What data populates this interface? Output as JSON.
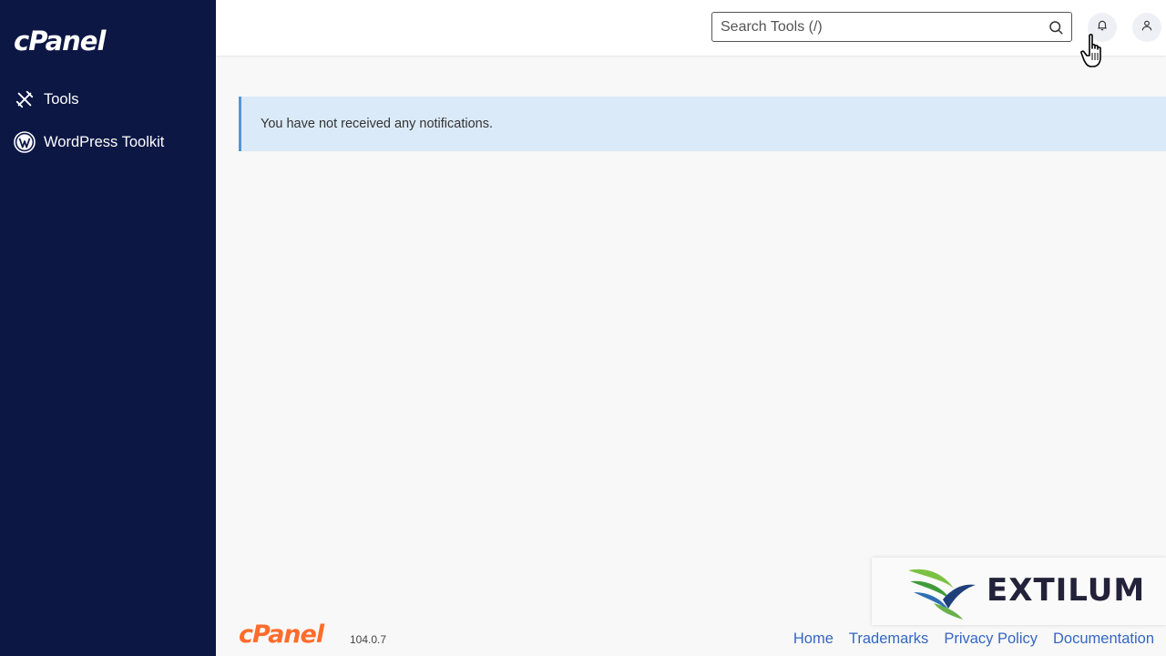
{
  "sidebar": {
    "logo": "cPanel",
    "items": [
      {
        "label": "Tools",
        "icon": "tools-icon"
      },
      {
        "label": "WordPress Toolkit",
        "icon": "wordpress-icon"
      }
    ]
  },
  "header": {
    "search": {
      "placeholder": "Search Tools (/)",
      "value": ""
    },
    "icons": [
      "bell-icon",
      "user-icon"
    ]
  },
  "notification": {
    "message": "You have not received any notifications."
  },
  "footer": {
    "logo": "cPanel",
    "version": "104.0.7",
    "links": [
      "Home",
      "Trademarks",
      "Privacy Policy",
      "Documentation"
    ]
  },
  "watermark": {
    "text": "EXTILUM"
  },
  "colors": {
    "sidebar_bg": "#0c1744",
    "brand_orange": "#ff6c2c",
    "notice_bg": "#dbeaf8",
    "notice_border": "#5795d2",
    "link": "#3566c2"
  }
}
